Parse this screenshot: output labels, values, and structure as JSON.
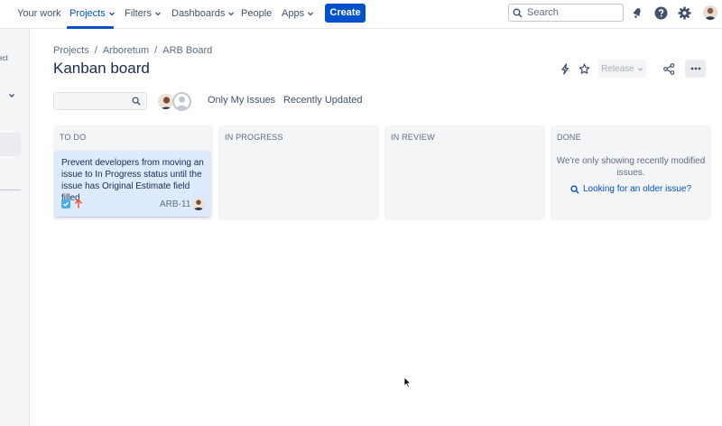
{
  "nav": {
    "your_work": "Your work",
    "projects": "Projects",
    "filters": "Filters",
    "dashboards": "Dashboards",
    "people": "People",
    "apps": "Apps",
    "create": "Create",
    "search_placeholder": "Search",
    "icons": [
      "notifications-icon",
      "help-icon",
      "settings-icon",
      "profile-avatar"
    ]
  },
  "sidebar": {
    "truncated_text": "ect"
  },
  "breadcrumb": [
    "Projects",
    "Arboretum",
    "ARB Board"
  ],
  "breadcrumb_sep": "/",
  "page_title": "Kanban board",
  "toolbar": {
    "release_label": "Release",
    "icons": [
      "automation-icon",
      "star-icon",
      "share-icon",
      "more-icon"
    ]
  },
  "filters": {
    "search_placeholder": "",
    "only_my_issues": "Only My Issues",
    "recently_updated": "Recently Updated"
  },
  "columns": [
    {
      "title": "TO DO"
    },
    {
      "title": "IN PROGRESS"
    },
    {
      "title": "IN REVIEW"
    },
    {
      "title": "DONE"
    }
  ],
  "card": {
    "summary": "Prevent developers from moving an issue to In Progress status until the issue has Original Estimate field filled",
    "key": "ARB-11",
    "type": "task",
    "priority": "high"
  },
  "done_column": {
    "message": "We're only showing recently modified issues.",
    "link": "Looking for an older issue?"
  },
  "colors": {
    "brand": "#0052cc",
    "card_bg": "#deebff",
    "column_bg": "#f4f5f7",
    "priority_high": "#ff5630",
    "task_icon": "#4bade8"
  }
}
